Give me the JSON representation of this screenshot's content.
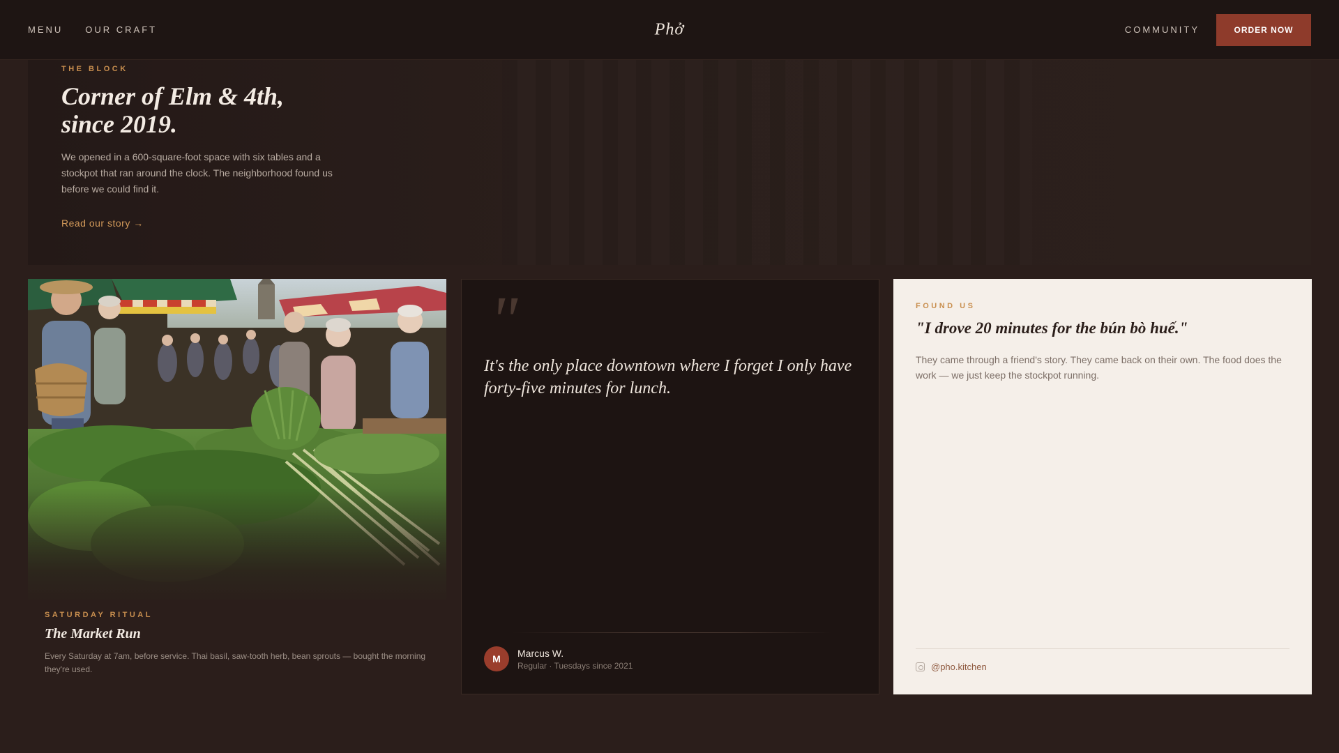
{
  "nav": {
    "menu_label": "MENU",
    "craft_label": "OUR CRAFT",
    "logo": "Phở",
    "community_label": "COMMUNITY",
    "order_label": "ORDER NOW"
  },
  "hero": {
    "eyebrow": "THE BLOCK",
    "title_line1": "Corner of Elm & 4th,",
    "title_line2": "since 2019.",
    "body": "We opened in a 600-square-foot space with six tables and a stockpot that ran around the clock. The neighborhood found us before we could find it.",
    "link": "Read our story",
    "link_arrow": "→"
  },
  "market_card": {
    "eyebrow": "SATURDAY RITUAL",
    "title": "The Market Run",
    "body": "Every Saturday at 7am, before service. Thai basil, saw-tooth herb, bean sprouts — bought the morning they're used."
  },
  "quote_card": {
    "quote_mark": "\"",
    "quote": "It's the only place downtown where I forget I only have forty-five minutes for lunch.",
    "avatar_initial": "M",
    "author": "Marcus W.",
    "author_meta": "Regular · Tuesdays since 2021"
  },
  "found_card": {
    "eyebrow": "FOUND US",
    "title": "\"I drove 20 minutes for the bún bò huế.\"",
    "body": "They came through a friend's story. They came back on their own. The food does the work — we just keep the stockpot running.",
    "handle": "@pho.kitchen",
    "handle_icon": "instagram-icon"
  },
  "colors": {
    "accent": "#8e3b2b",
    "eyebrow_gold": "#c98f4f",
    "page_bg": "#2b1e1b",
    "nav_bg": "#1e1513",
    "cream": "#f5efe9"
  }
}
